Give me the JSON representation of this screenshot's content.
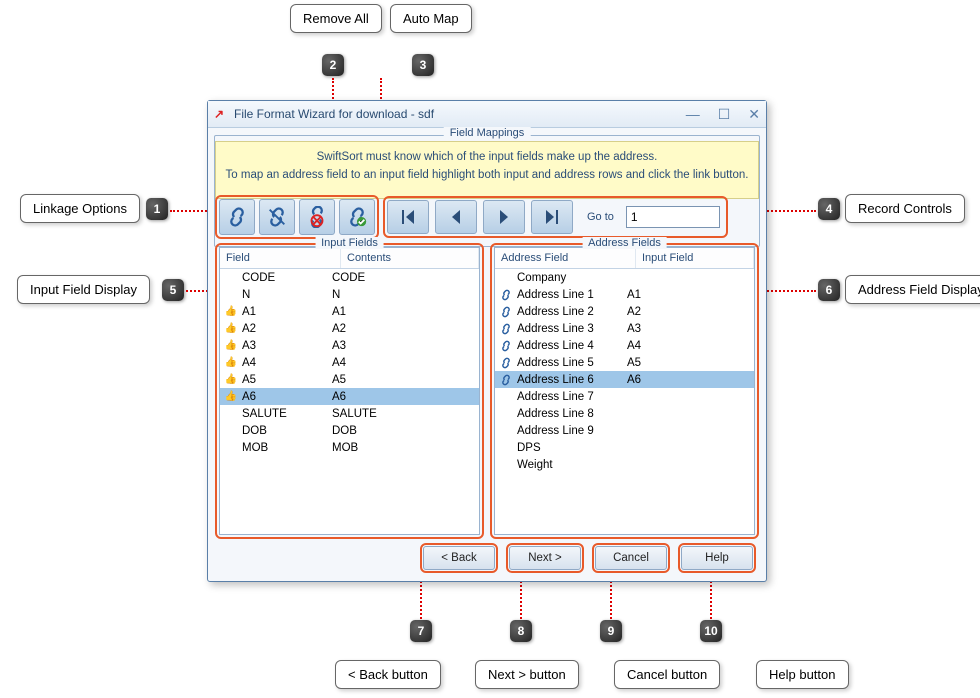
{
  "callouts": {
    "c1": "Linkage Options",
    "c2": "Remove All",
    "c3": "Auto Map",
    "c4": "Record Controls",
    "c5": "Input Field Display",
    "c6": "Address Field Display",
    "c7": "< Back button",
    "c8": "Next > button",
    "c9": "Cancel button",
    "c10": "Help button"
  },
  "window_title": "File Format Wizard for download - sdf",
  "fieldset_mappings": "Field Mappings",
  "banner_line1": "SwiftSort must know which of the input fields make up the address.",
  "banner_line2": "To map an address field to an input field highlight both input and address rows and click the link button.",
  "nav": {
    "goto_label": "Go to",
    "goto_value": "1"
  },
  "input_panel": {
    "legend": "Input Fields",
    "col_field": "Field",
    "col_contents": "Contents",
    "rows": [
      {
        "linked": false,
        "field": "CODE",
        "contents": "CODE"
      },
      {
        "linked": false,
        "field": "N",
        "contents": "N"
      },
      {
        "linked": true,
        "field": "A1",
        "contents": "A1"
      },
      {
        "linked": true,
        "field": "A2",
        "contents": "A2"
      },
      {
        "linked": true,
        "field": "A3",
        "contents": "A3"
      },
      {
        "linked": true,
        "field": "A4",
        "contents": "A4"
      },
      {
        "linked": true,
        "field": "A5",
        "contents": "A5"
      },
      {
        "linked": true,
        "field": "A6",
        "contents": "A6",
        "selected": true
      },
      {
        "linked": false,
        "field": "SALUTE",
        "contents": "SALUTE"
      },
      {
        "linked": false,
        "field": "DOB",
        "contents": "DOB"
      },
      {
        "linked": false,
        "field": "MOB",
        "contents": "MOB"
      }
    ]
  },
  "address_panel": {
    "legend": "Address Fields",
    "col_addr": "Address Field",
    "col_input": "Input Field",
    "rows": [
      {
        "linked": false,
        "addr": "Company",
        "input": ""
      },
      {
        "linked": true,
        "addr": "Address Line 1",
        "input": "A1"
      },
      {
        "linked": true,
        "addr": "Address Line 2",
        "input": "A2"
      },
      {
        "linked": true,
        "addr": "Address Line 3",
        "input": "A3"
      },
      {
        "linked": true,
        "addr": "Address Line 4",
        "input": "A4"
      },
      {
        "linked": true,
        "addr": "Address Line 5",
        "input": "A5"
      },
      {
        "linked": true,
        "addr": "Address Line 6",
        "input": "A6",
        "selected": true
      },
      {
        "linked": false,
        "addr": "Address Line 7",
        "input": ""
      },
      {
        "linked": false,
        "addr": "Address Line 8",
        "input": ""
      },
      {
        "linked": false,
        "addr": "Address Line 9",
        "input": ""
      },
      {
        "linked": false,
        "addr": "DPS",
        "input": ""
      },
      {
        "linked": false,
        "addr": "Weight",
        "input": ""
      }
    ]
  },
  "buttons": {
    "back": "< Back",
    "next": "Next >",
    "cancel": "Cancel",
    "help": "Help"
  }
}
